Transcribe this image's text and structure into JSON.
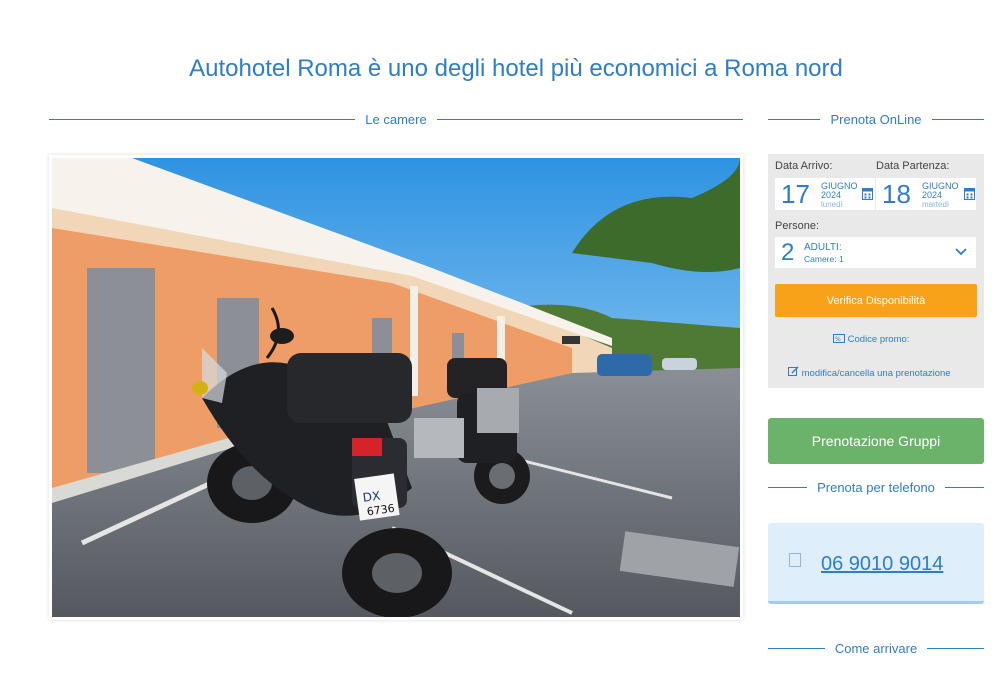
{
  "heading": "Autohotel Roma è uno degli hotel più economici a Roma nord",
  "sections": {
    "rooms": "Le camere",
    "book_online": "Prenota OnLine",
    "book_phone": "Prenota per telefono",
    "directions": "Come arrivare"
  },
  "booking": {
    "arrival_label": "Data Arrivo:",
    "departure_label": "Data Partenza:",
    "arrival": {
      "day": "17",
      "month": "GIUGNO",
      "year": "2024",
      "weekday": "lunedì"
    },
    "departure": {
      "day": "18",
      "month": "GIUGNO",
      "year": "2024",
      "weekday": "martedì"
    },
    "persons_label": "Persone:",
    "persons_count": "2",
    "persons_type": "ADULTI:",
    "rooms_text": "Camere: 1",
    "verify_button": "Verifica Disponibilità",
    "promo_link": "Codice promo:",
    "modify_link": "modifica/cancella una prenotazione"
  },
  "groups_button": "Prenotazione Gruppi",
  "phone": {
    "number": "06 9010 9014"
  },
  "colors": {
    "brand_blue": "#2f7ec5",
    "verify_orange": "#f8a21a",
    "groups_green": "#6bb36a",
    "box_gray": "#e9e9e9"
  },
  "icons": {
    "calendar": "calendar-icon",
    "chevron": "chevron-down-icon",
    "promo": "promo-code-icon",
    "edit": "edit-icon",
    "phone": "phone-icon"
  }
}
